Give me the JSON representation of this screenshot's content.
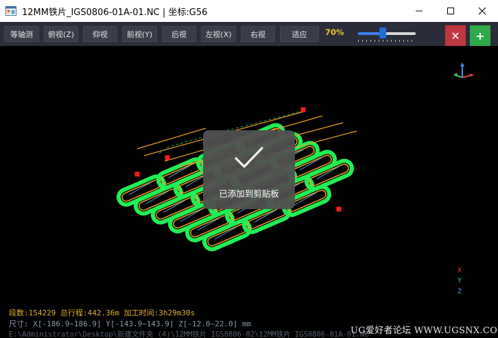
{
  "window": {
    "title": "12MM铁片_IGS0806-01A-01.NC | 坐标:G56",
    "min_icon": "minimize-icon",
    "max_icon": "maximize-icon",
    "close_icon": "close-icon"
  },
  "toolbar": {
    "buttons": [
      "等轴测",
      "俯视(Z)",
      "仰视",
      "前视(Y)",
      "后视",
      "左视(X)",
      "右视",
      "适应"
    ],
    "zoom_percent": "70%",
    "zoom_value": 0.7,
    "slider_position": 0.42,
    "close_label": "✕",
    "add_label": "+"
  },
  "colors": {
    "toolbar_bg": "#2b2d3a",
    "viewport_bg": "#000000",
    "toolpath_green": "#22ee55",
    "toolpath_orange": "#f0a020",
    "marker_red": "#ff1a1a",
    "close_red": "#c0373f",
    "add_green": "#2faa4a",
    "zoom_text": "#f0c030"
  },
  "toast": {
    "icon": "checkmark-icon",
    "message": "已添加到剪贴板"
  },
  "axes": {
    "x": "X",
    "y": "Y",
    "z": "Z"
  },
  "info": {
    "line1": "段数:154229  总行程:442.36m  加工时间:3h29m30s",
    "line2": "尺寸: X[-186.9~186.9]  Y[-143.9~143.9]  Z[-12.0~22.0] mm",
    "line3": "E:\\Administrator\\Desktop\\新建文件夹 (4)\\12MM铁片_IGS0806-02\\12MM铁片_IGS0806-01A-01.NC"
  },
  "watermark": "UG爱好者论坛 WWW.UGSNX.COM"
}
